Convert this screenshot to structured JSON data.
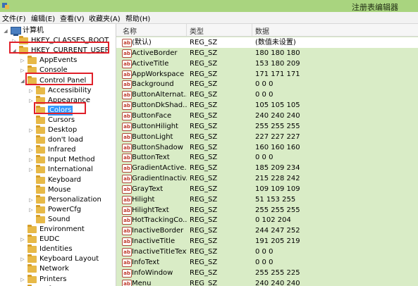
{
  "window": {
    "title": "注册表编辑器",
    "colors": {
      "titlebar": "#a9d47f",
      "list_bg": "#d9ecc6",
      "highlight_box": "#e0202a"
    }
  },
  "menu": [
    {
      "label": "文件(F)"
    },
    {
      "label": "编辑(E)"
    },
    {
      "label": "查看(V)"
    },
    {
      "label": "收藏夹(A)"
    },
    {
      "label": "帮助(H)"
    }
  ],
  "tree": [
    {
      "label": "计算机",
      "icon": "computer-icon",
      "expander": "◢",
      "level": 0
    },
    {
      "label": "HKEY_CLASSES_ROOT",
      "icon": "folder-icon",
      "expander": "▷",
      "level": 1
    },
    {
      "label": "HKEY_CURRENT_USER",
      "icon": "folder-icon",
      "expander": "◢",
      "level": 1
    },
    {
      "label": "AppEvents",
      "icon": "folder-icon",
      "expander": "▷",
      "level": 2
    },
    {
      "label": "Console",
      "icon": "folder-icon",
      "expander": "▷",
      "level": 2
    },
    {
      "label": "Control Panel",
      "icon": "folder-icon",
      "expander": "◢",
      "level": 2
    },
    {
      "label": "Accessibility",
      "icon": "folder-icon",
      "expander": "▷",
      "level": 3
    },
    {
      "label": "Appearance",
      "icon": "folder-icon",
      "expander": "▷",
      "level": 3
    },
    {
      "label": "Colors",
      "icon": "folder-icon",
      "expander": "",
      "level": 3,
      "selected": true
    },
    {
      "label": "Cursors",
      "icon": "folder-icon",
      "expander": "",
      "level": 3
    },
    {
      "label": "Desktop",
      "icon": "folder-icon",
      "expander": "▷",
      "level": 3
    },
    {
      "label": "don't load",
      "icon": "folder-icon",
      "expander": "",
      "level": 3
    },
    {
      "label": "Infrared",
      "icon": "folder-icon",
      "expander": "▷",
      "level": 3
    },
    {
      "label": "Input Method",
      "icon": "folder-icon",
      "expander": "▷",
      "level": 3
    },
    {
      "label": "International",
      "icon": "folder-icon",
      "expander": "▷",
      "level": 3
    },
    {
      "label": "Keyboard",
      "icon": "folder-icon",
      "expander": "",
      "level": 3
    },
    {
      "label": "Mouse",
      "icon": "folder-icon",
      "expander": "",
      "level": 3
    },
    {
      "label": "Personalization",
      "icon": "folder-icon",
      "expander": "▷",
      "level": 3
    },
    {
      "label": "PowerCfg",
      "icon": "folder-icon",
      "expander": "▷",
      "level": 3
    },
    {
      "label": "Sound",
      "icon": "folder-icon",
      "expander": "",
      "level": 3
    },
    {
      "label": "Environment",
      "icon": "folder-icon",
      "expander": "",
      "level": 2
    },
    {
      "label": "EUDC",
      "icon": "folder-icon",
      "expander": "▷",
      "level": 2
    },
    {
      "label": "Identities",
      "icon": "folder-icon",
      "expander": "",
      "level": 2
    },
    {
      "label": "Keyboard Layout",
      "icon": "folder-icon",
      "expander": "▷",
      "level": 2
    },
    {
      "label": "Network",
      "icon": "folder-icon",
      "expander": "",
      "level": 2
    },
    {
      "label": "Printers",
      "icon": "folder-icon",
      "expander": "▷",
      "level": 2
    },
    {
      "label": "Software",
      "icon": "folder-icon",
      "expander": "▷",
      "level": 2
    }
  ],
  "list": {
    "headers": {
      "name": "名称",
      "type": "类型",
      "data": "数据"
    },
    "value_icon": "string-value-icon",
    "rows": [
      {
        "name": "(默认)",
        "type": "REG_SZ",
        "data": "(数值未设置)"
      },
      {
        "name": "ActiveBorder",
        "type": "REG_SZ",
        "data": "180 180 180"
      },
      {
        "name": "ActiveTitle",
        "type": "REG_SZ",
        "data": "153 180 209"
      },
      {
        "name": "AppWorkspace",
        "type": "REG_SZ",
        "data": "171 171 171"
      },
      {
        "name": "Background",
        "type": "REG_SZ",
        "data": "0 0 0"
      },
      {
        "name": "ButtonAlternat...",
        "type": "REG_SZ",
        "data": "0 0 0"
      },
      {
        "name": "ButtonDkShad...",
        "type": "REG_SZ",
        "data": "105 105 105"
      },
      {
        "name": "ButtonFace",
        "type": "REG_SZ",
        "data": "240 240 240"
      },
      {
        "name": "ButtonHilight",
        "type": "REG_SZ",
        "data": "255 255 255"
      },
      {
        "name": "ButtonLight",
        "type": "REG_SZ",
        "data": "227 227 227"
      },
      {
        "name": "ButtonShadow",
        "type": "REG_SZ",
        "data": "160 160 160"
      },
      {
        "name": "ButtonText",
        "type": "REG_SZ",
        "data": "0 0 0"
      },
      {
        "name": "GradientActive...",
        "type": "REG_SZ",
        "data": "185 209 234"
      },
      {
        "name": "GradientInactiv...",
        "type": "REG_SZ",
        "data": "215 228 242"
      },
      {
        "name": "GrayText",
        "type": "REG_SZ",
        "data": "109 109 109"
      },
      {
        "name": "Hilight",
        "type": "REG_SZ",
        "data": "51 153 255"
      },
      {
        "name": "HilightText",
        "type": "REG_SZ",
        "data": "255 255 255"
      },
      {
        "name": "HotTrackingCo...",
        "type": "REG_SZ",
        "data": "0 102 204"
      },
      {
        "name": "InactiveBorder",
        "type": "REG_SZ",
        "data": "244 247 252"
      },
      {
        "name": "InactiveTitle",
        "type": "REG_SZ",
        "data": "191 205 219"
      },
      {
        "name": "InactiveTitleText",
        "type": "REG_SZ",
        "data": "0 0 0"
      },
      {
        "name": "InfoText",
        "type": "REG_SZ",
        "data": "0 0 0"
      },
      {
        "name": "InfoWindow",
        "type": "REG_SZ",
        "data": "255 255 225"
      },
      {
        "name": "Menu",
        "type": "REG_SZ",
        "data": "240 240 240"
      }
    ]
  }
}
